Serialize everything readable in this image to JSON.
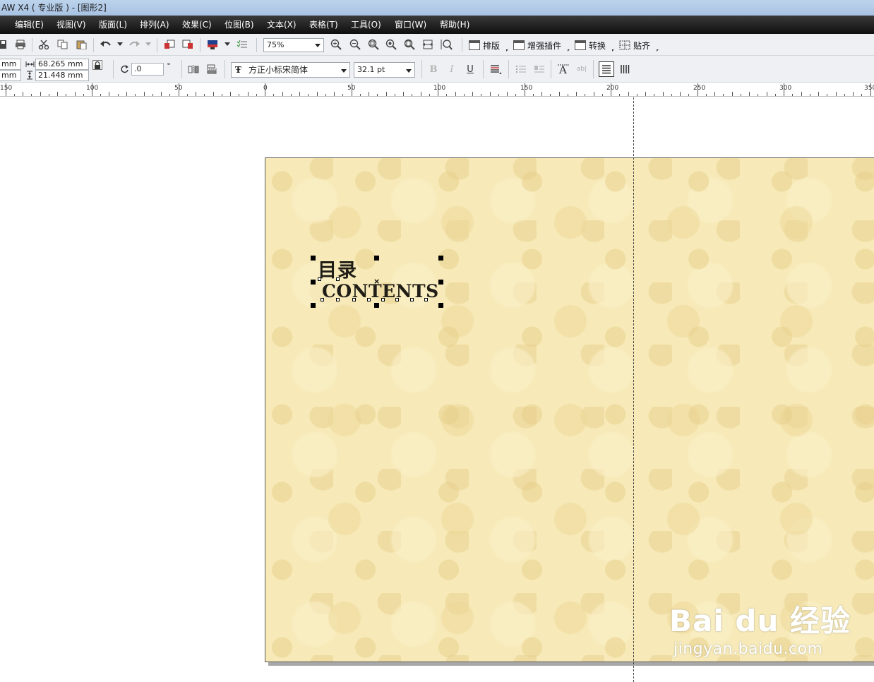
{
  "window": {
    "title": "AW X4 ( 专业版 ) - [图形2]"
  },
  "menu": [
    {
      "label": "编辑(E)"
    },
    {
      "label": "视图(V)"
    },
    {
      "label": "版面(L)"
    },
    {
      "label": "排列(A)"
    },
    {
      "label": "效果(C)"
    },
    {
      "label": "位图(B)"
    },
    {
      "label": "文本(X)"
    },
    {
      "label": "表格(T)"
    },
    {
      "label": "工具(O)"
    },
    {
      "label": "窗口(W)"
    },
    {
      "label": "帮助(H)"
    }
  ],
  "toolbar": {
    "zoom": "75%",
    "plugins": [
      {
        "label": "排版"
      },
      {
        "label": "增强插件"
      },
      {
        "label": "转换"
      },
      {
        "label": "贴齐"
      }
    ]
  },
  "propertybar": {
    "x_unit_partial": "mm",
    "y_unit_partial": "mm",
    "width": "68.265 mm",
    "height": "21.448 mm",
    "rotation": ".0",
    "degree_symbol": "°",
    "font_name": "方正小标宋简体",
    "font_size": "32.1 pt"
  },
  "ruler": {
    "labels": [
      "150",
      "100",
      "50",
      "0",
      "50",
      "100",
      "150",
      "200",
      "250",
      "300",
      "350"
    ]
  },
  "document": {
    "text_line1": "目录",
    "text_line2": "CONTENTS"
  },
  "watermark": {
    "main": "Bai  du 经验",
    "sub": "jingyan.baidu.com"
  },
  "colors": {
    "page_background": "#f7eab8",
    "menubar_bg": "#1a1a1a",
    "titlebar_bg": "#b4cce8"
  }
}
